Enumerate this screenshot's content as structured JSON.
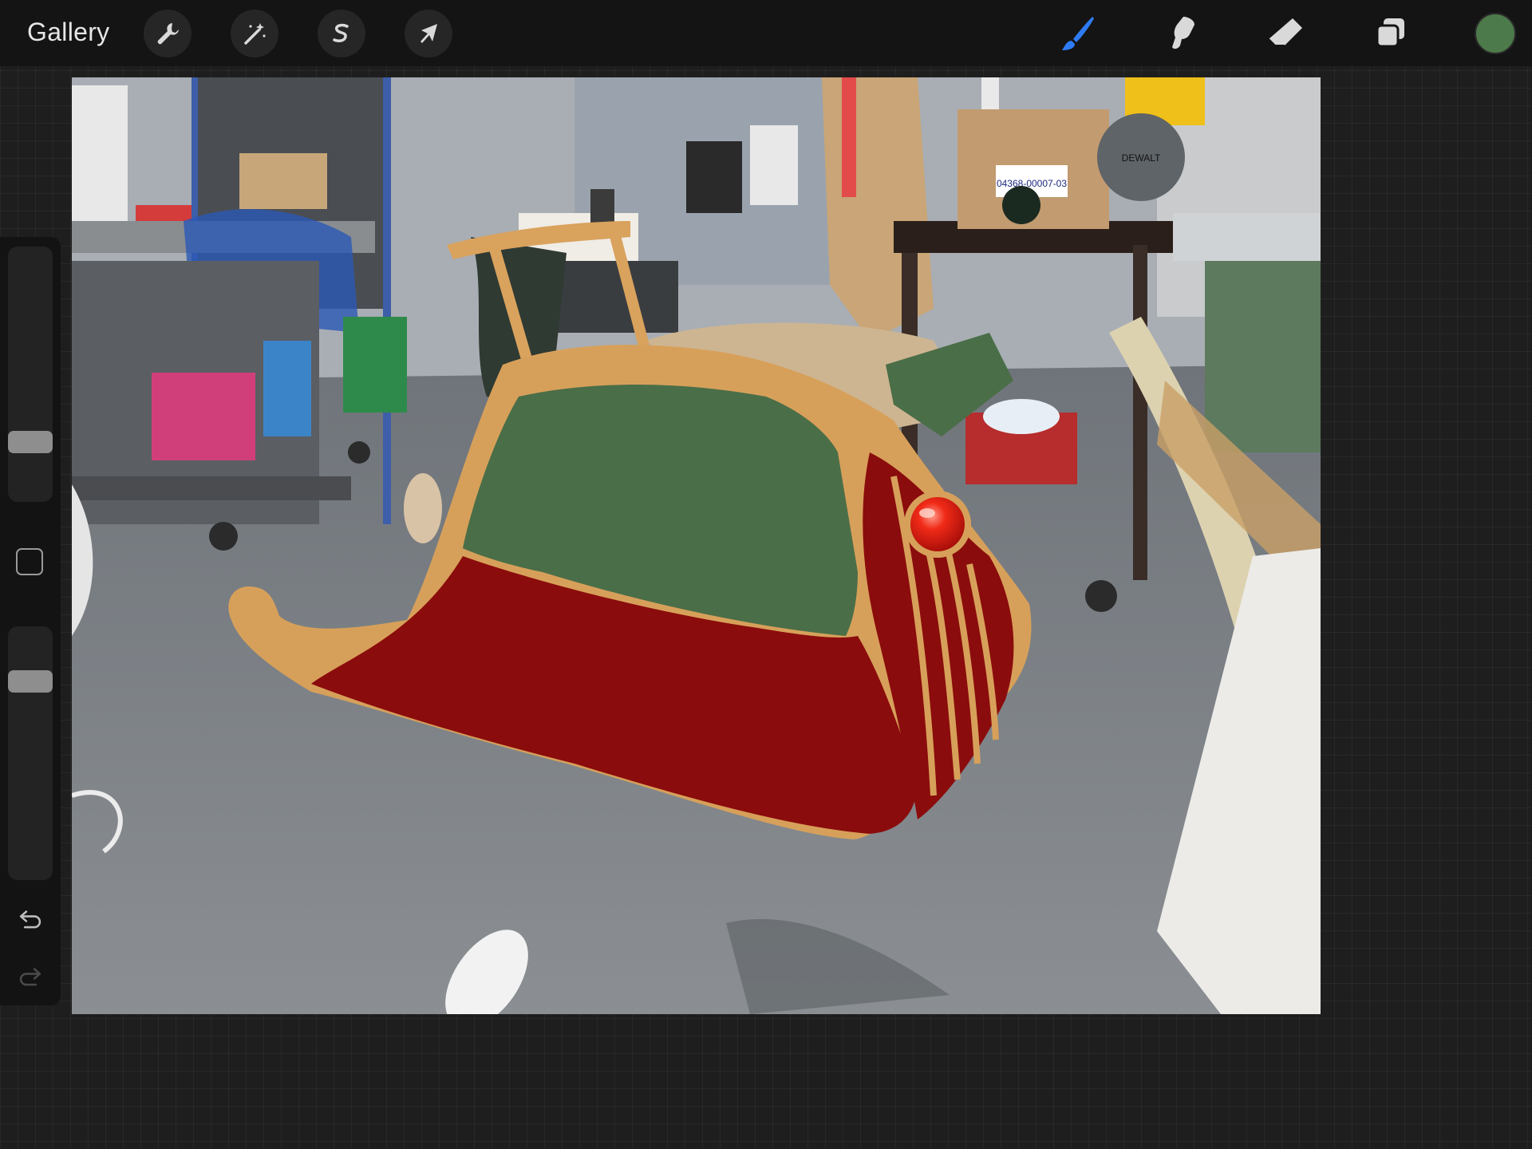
{
  "toolbar": {
    "gallery_label": "Gallery",
    "left_tools": [
      {
        "name": "actions",
        "icon": "wrench-icon"
      },
      {
        "name": "adjustments",
        "icon": "magic-wand-icon"
      },
      {
        "name": "selection",
        "icon": "selection-s-icon"
      },
      {
        "name": "transform",
        "icon": "cursor-arrow-icon"
      }
    ],
    "right_tools": [
      {
        "name": "brush",
        "icon": "brush-icon",
        "active": true
      },
      {
        "name": "smudge",
        "icon": "smudge-icon",
        "active": false
      },
      {
        "name": "eraser",
        "icon": "eraser-icon",
        "active": false
      },
      {
        "name": "layers",
        "icon": "layers-icon",
        "active": false
      }
    ],
    "active_color": "#4d7a4a",
    "accent_color": "#2f7bf5"
  },
  "sidebar": {
    "brush_size_level": 0.2,
    "opacity_level": 0.82,
    "modify_icon": "square-icon",
    "undo_icon": "undo-icon",
    "redo_icon": "redo-icon"
  },
  "canvas": {
    "content": "photo-of-workshop-with-painted-sleigh",
    "palette": {
      "sleigh_red": "#8b0c0c",
      "sleigh_green": "#4a6e48",
      "sleigh_tan": "#d7a05a",
      "jewel_red": "#e01a12"
    },
    "box_label": "04368-00007-03",
    "saw_brand": "DEWALT"
  }
}
